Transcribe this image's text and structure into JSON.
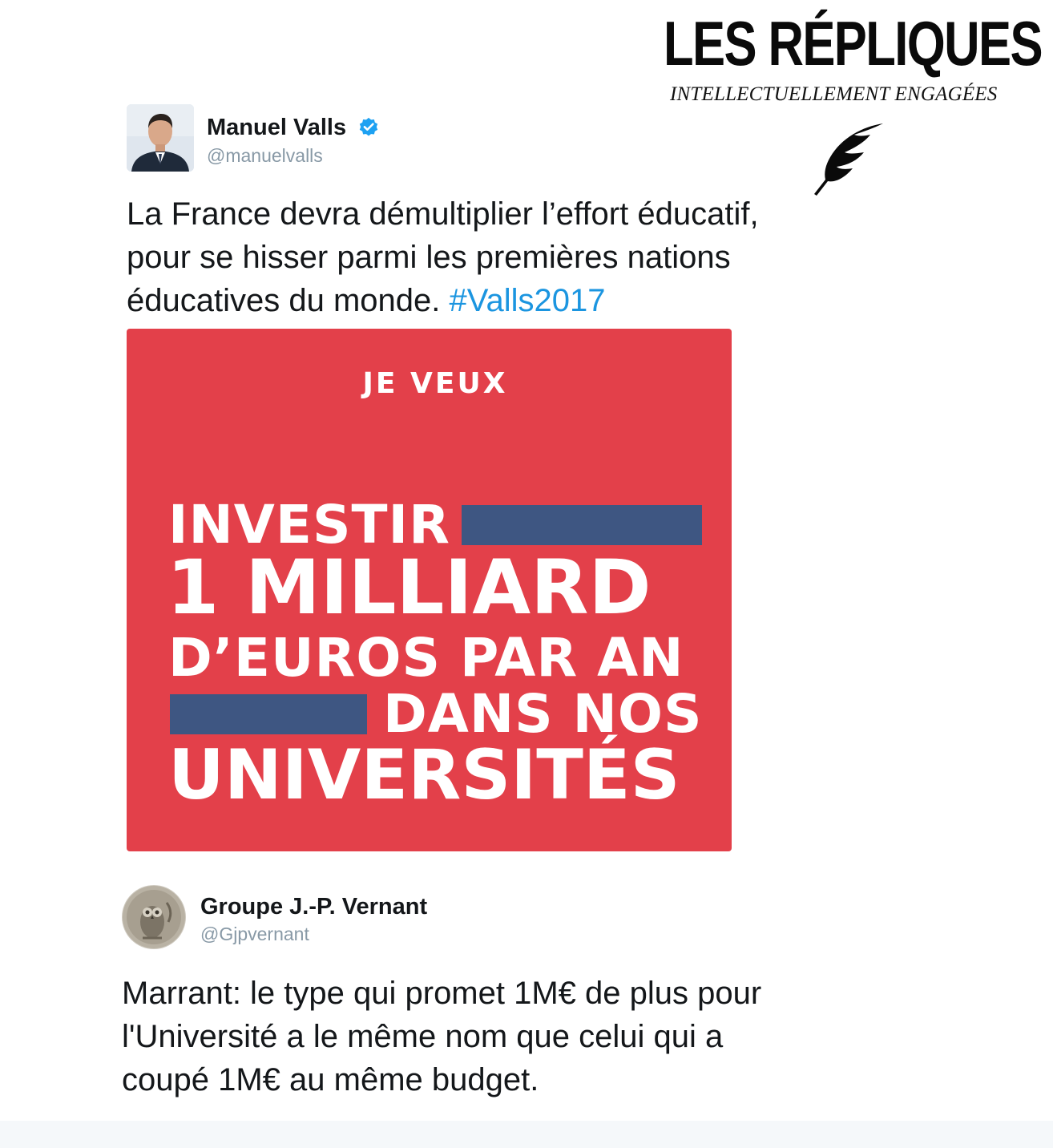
{
  "branding": {
    "title": "LES RÉPLIQUES",
    "tagline": "INTELLECTUELLEMENT ENGAGÉES"
  },
  "tweet1": {
    "author_name": "Manuel Valls",
    "author_handle": "@manuelvalls",
    "verified": true,
    "text_lines": [
      "La France devra démultiplier l’effort éducatif,",
      "pour se hisser parmi les premières nations",
      "éducatives du monde. "
    ],
    "hashtag": "#Valls2017",
    "poster": {
      "kicker": "JE VEUX",
      "line1": "INVESTIR",
      "line2": "1 MILLIARD",
      "line3": "D’EUROS PAR AN",
      "line4": "DANS NOS",
      "line5": "UNIVERSITÉS"
    }
  },
  "tweet2": {
    "author_name": "Groupe J.-P. Vernant",
    "author_handle": "@Gjpvernant",
    "text_lines": [
      "Marrant: le type qui promet 1M€ de plus pour",
      "l'Université a le même nom que celui qui a",
      "coupé 1M€ au même budget."
    ]
  },
  "colors": {
    "poster_red": "#e3404a",
    "poster_bar_blue": "#3e5682",
    "hashtag_blue": "#1b95e0",
    "handle_gray": "#8899a6",
    "verified_blue": "#1da1f2"
  },
  "icons": {
    "verified": "verified-badge-icon",
    "quill": "quill-feather-icon"
  }
}
